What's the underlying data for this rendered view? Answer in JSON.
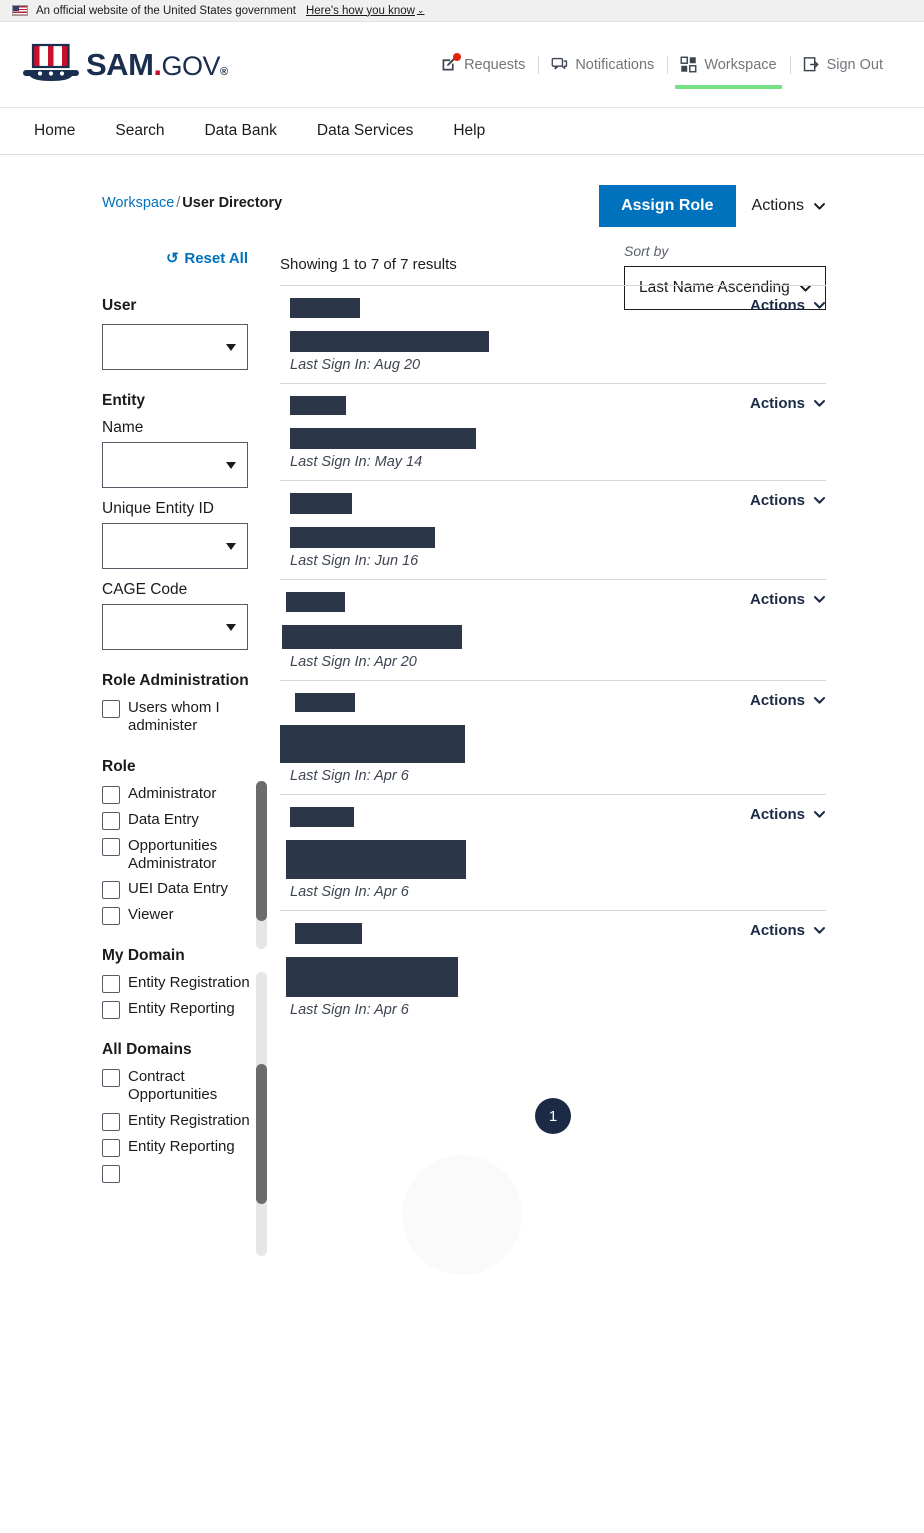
{
  "gov_banner": {
    "text": "An official website of the United States government",
    "link": "Here's how you know",
    "caret": "⌄",
    "flag_icon": "us-flag-icon"
  },
  "masthead": {
    "logo": {
      "sam": "SAM",
      "dot": ".",
      "gov": "GOV",
      "reg": "®"
    },
    "util_nav": [
      {
        "label": "Requests",
        "icon": "edit-pencil-icon",
        "badge": true,
        "active": false
      },
      {
        "label": "Notifications",
        "icon": "chat-bubble-icon",
        "badge": false,
        "active": false
      },
      {
        "label": "Workspace",
        "icon": "grid-squares-icon",
        "badge": false,
        "active": true
      },
      {
        "label": "Sign Out",
        "icon": "sign-out-arrow-icon",
        "badge": false,
        "active": false
      }
    ]
  },
  "primary_nav": [
    {
      "label": "Home"
    },
    {
      "label": "Search"
    },
    {
      "label": "Data Bank"
    },
    {
      "label": "Data Services"
    },
    {
      "label": "Help"
    }
  ],
  "breadcrumb": {
    "parent": "Workspace",
    "separator": "/",
    "current": "User Directory"
  },
  "toolbar": {
    "assign_role_label": "Assign Role",
    "actions_label": "Actions",
    "chevron_icon": "chevron-down-icon"
  },
  "sort": {
    "label": "Sort by",
    "value": "Last Name Ascending",
    "chevron_icon": "chevron-down-icon"
  },
  "filters": {
    "reset_label": "Reset All",
    "reset_icon": "reset-circular-arrow-icon",
    "groups": [
      {
        "title": "User",
        "type": "selects",
        "fields": [
          {
            "label": "",
            "value": ""
          }
        ]
      },
      {
        "title": "Entity",
        "type": "selects",
        "fields": [
          {
            "label": "Name",
            "value": ""
          },
          {
            "label": "Unique Entity ID",
            "value": ""
          },
          {
            "label": "CAGE Code",
            "value": ""
          }
        ]
      },
      {
        "title": "Role Administration",
        "type": "checkboxes",
        "options": [
          "Users whom I administer"
        ],
        "scroll": false
      },
      {
        "title": "Role",
        "type": "checkboxes",
        "options": [
          "Administrator",
          "Data Entry",
          "Opportunities Administrator",
          "UEI Data Entry",
          "Viewer"
        ],
        "scroll": true
      },
      {
        "title": "My Domain",
        "type": "checkboxes",
        "options": [
          "Entity Registration",
          "Entity Reporting"
        ],
        "scroll": true
      },
      {
        "title": "All Domains",
        "type": "checkboxes",
        "options": [
          "Contract Opportunities",
          "Entity Registration",
          "Entity Reporting"
        ],
        "scroll": true
      }
    ]
  },
  "results": {
    "showing_text": "Showing 1 to 7 of 7 results",
    "row_action_label": "Actions",
    "signin_prefix": "Last Sign In: ",
    "redaction_color": "#2b3748",
    "rows": [
      {
        "name_w": 70,
        "name_h": 20,
        "org_w": 199,
        "org_h": 21,
        "last_sign_in": "Aug 20"
      },
      {
        "name_w": 56,
        "name_h": 19,
        "org_w": 186,
        "org_h": 21,
        "last_sign_in": "May 14"
      },
      {
        "name_w": 62,
        "name_h": 21,
        "org_w": 145,
        "org_h": 21,
        "last_sign_in": "Jun 16"
      },
      {
        "name_w": 59,
        "name_h": 20,
        "org_w": 180,
        "org_h": 24,
        "last_sign_in": "Apr 20"
      },
      {
        "name_w": 60,
        "name_h": 19,
        "org_w": 185,
        "org_h": 38,
        "last_sign_in": "Apr 6"
      },
      {
        "name_w": 64,
        "name_h": 20,
        "org_w": 180,
        "org_h": 39,
        "last_sign_in": "Apr 6"
      },
      {
        "name_w": 67,
        "name_h": 21,
        "org_w": 172,
        "org_h": 40,
        "last_sign_in": "Apr 6"
      }
    ]
  },
  "pagination": {
    "current_page": "1"
  },
  "colors": {
    "primary_blue": "#0071bc",
    "link_blue": "#0071bc",
    "navy": "#1b2a45",
    "green_accent": "#76e084",
    "redaction": "#2b3748"
  }
}
